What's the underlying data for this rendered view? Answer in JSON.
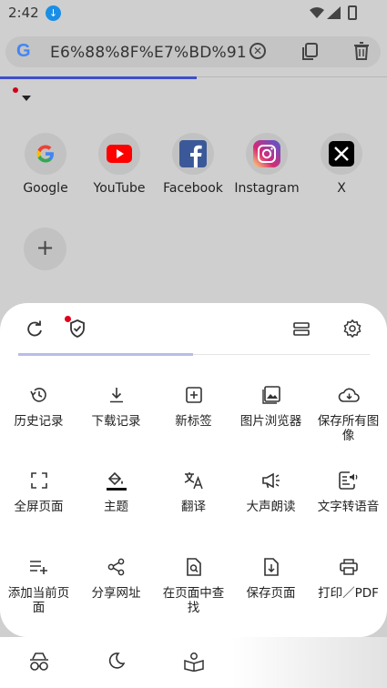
{
  "status_bar": {
    "time": "2:42"
  },
  "url_bar": {
    "value": "E6%88%8F%E7%BD%91",
    "engine_logo": "G"
  },
  "shortcuts": [
    {
      "label": "Google"
    },
    {
      "label": "YouTube"
    },
    {
      "label": "Facebook"
    },
    {
      "label": "Instagram"
    },
    {
      "label": "X"
    }
  ],
  "menu": {
    "progress_percent": 51,
    "items": [
      {
        "label": "历史记录",
        "icon": "history-icon"
      },
      {
        "label": "下载记录",
        "icon": "download-icon"
      },
      {
        "label": "新标签",
        "icon": "new-tab-icon"
      },
      {
        "label": "图片浏览器",
        "icon": "image-icon"
      },
      {
        "label": "保存所有图像",
        "icon": "cloud-download-icon"
      },
      {
        "label": "全屏页面",
        "icon": "fullscreen-icon"
      },
      {
        "label": "主题",
        "icon": "paint-bucket-icon"
      },
      {
        "label": "翻译",
        "icon": "translate-icon"
      },
      {
        "label": "大声朗读",
        "icon": "megaphone-icon"
      },
      {
        "label": "文字转语音",
        "icon": "text-to-speech-icon"
      },
      {
        "label": "添加当前页面",
        "icon": "playlist-add-icon"
      },
      {
        "label": "分享网址",
        "icon": "share-icon"
      },
      {
        "label": "在页面中查找",
        "icon": "find-in-page-icon"
      },
      {
        "label": "保存页面",
        "icon": "save-page-icon"
      },
      {
        "label": "打印／PDF",
        "icon": "print-icon"
      }
    ]
  },
  "colors": {
    "accent": "#3f4fc9",
    "badge": "#e0001a"
  }
}
